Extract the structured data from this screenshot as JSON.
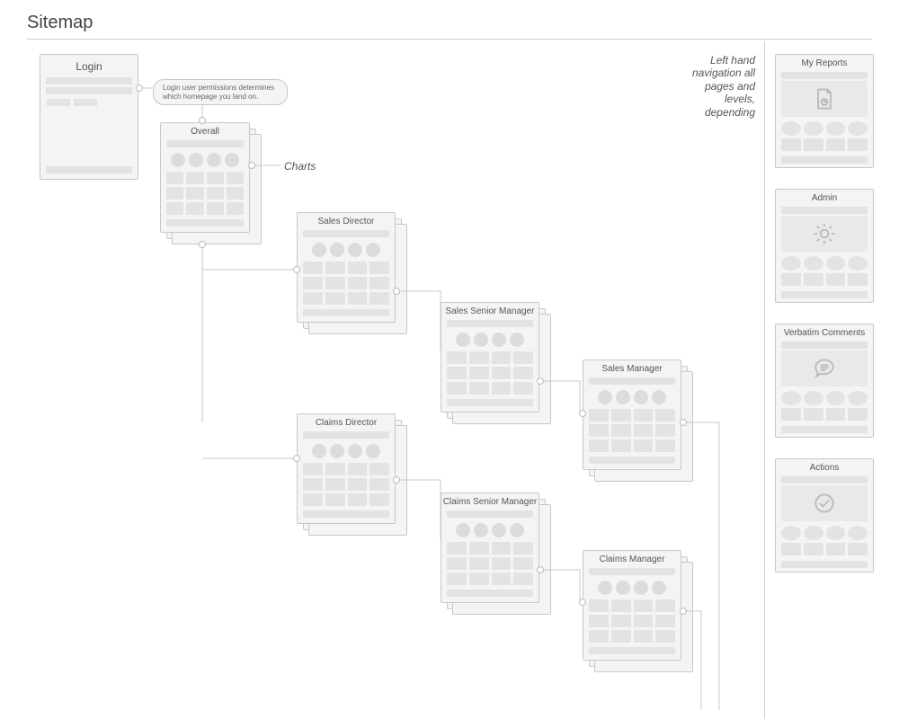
{
  "title": "Sitemap",
  "login": {
    "label": "Login"
  },
  "bubble_text": "Login user permissions determines which homepage you land on.",
  "charts_annotation": "Charts",
  "side_annotation": "Left hand navigation all pages and levels, depending",
  "pages": {
    "overall": "Overall",
    "sales_director": "Sales Director",
    "sales_senior_manager": "Sales Senior Manager",
    "sales_manager": "Sales Manager",
    "claims_director": "Claims Director",
    "claims_senior_manager": "Claims Senior Manager",
    "claims_manager": "Claims Manager"
  },
  "side": {
    "my_reports": "My Reports",
    "admin": "Admin",
    "verbatim": "Verbatim Comments",
    "actions": "Actions"
  }
}
